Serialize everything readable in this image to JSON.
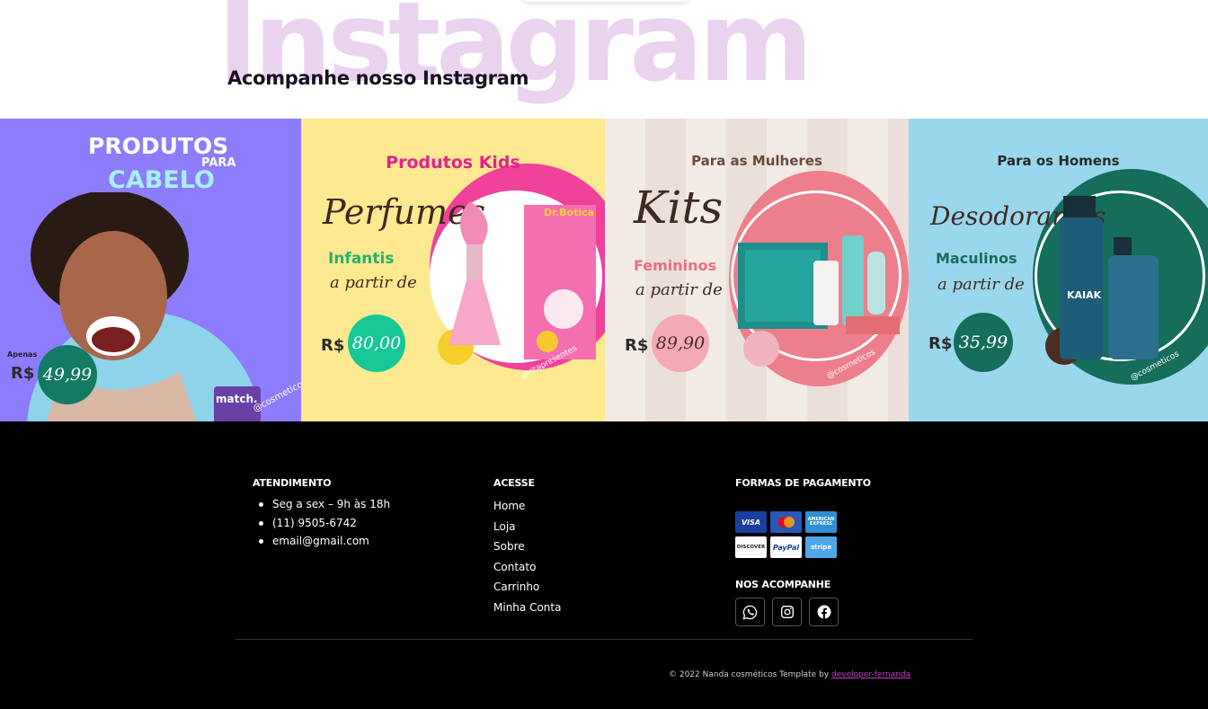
{
  "section": {
    "watermark": "Instagram",
    "title": "Acompanhe nosso Instagram"
  },
  "gallery": {
    "post1": {
      "heading_top": "PRODUTOS",
      "heading_mid": "PARA",
      "heading_bottom": "CABELO",
      "apenas": "Apenas",
      "currency": "R$",
      "price": "49,99",
      "handle": "@cosmeticos",
      "product": "match."
    },
    "post2": {
      "heading": "Produtos Kids",
      "script": "Perfumes",
      "sub": "Infantis",
      "script2": "a partir de",
      "currency": "R$",
      "price": "80,00",
      "handle": "@ritapresentes",
      "brand": "Dr.Botica"
    },
    "post3": {
      "heading": "Para as Mulheres",
      "script": "Kits",
      "sub": "Femininos",
      "script2": "a partir de",
      "currency": "R$",
      "price": "89,90",
      "handle": "@cosmeticos"
    },
    "post4": {
      "heading": "Para os Homens",
      "script": "Desodorantes",
      "sub": "Maculinos",
      "script2": "a partir de",
      "currency": "R$",
      "price": "35,99",
      "handle": "@cosmeticos",
      "product": "KAIAK"
    }
  },
  "footer": {
    "atendimento": {
      "title": "ATENDIMENTO",
      "items": [
        "Seg a sex – 9h às 18h",
        "(11) 9505-6742",
        "email@gmail.com"
      ]
    },
    "acesse": {
      "title": "ACESSE",
      "links": [
        "Home",
        "Loja",
        "Sobre",
        "Contato",
        "Carrinho",
        "Minha Conta"
      ]
    },
    "pagamento": {
      "title": "FORMAS DE PAGAMENTO",
      "cards": [
        "VISA",
        "mastercard",
        "AMERICAN EXPRESS",
        "DISCOVER",
        "PayPal",
        "stripe"
      ]
    },
    "social": {
      "title": "NOS ACOMPANHE",
      "icons": [
        "whatsapp-icon",
        "instagram-icon",
        "facebook-icon"
      ]
    },
    "copyright": "© 2022 Nanda cosméticos Template by",
    "credit_link": "developer-fernanda"
  },
  "colors": {
    "watermark": "#ead3ee",
    "credit_link": "#c13cc6",
    "footer_bg": "#000000"
  }
}
